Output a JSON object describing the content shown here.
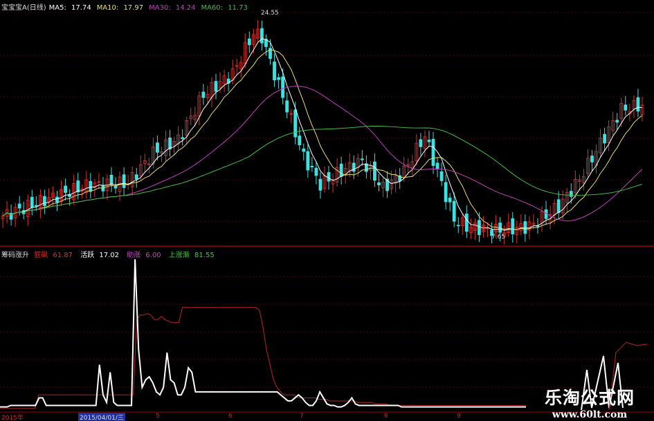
{
  "main_panel": {
    "title": "宝宝宝A(日线)",
    "ma5": {
      "label": "MA5:",
      "value": "17.74",
      "color": "#ffffff"
    },
    "ma10": {
      "label": "MA10:",
      "value": "17.97",
      "color": "#e8e070"
    },
    "ma30": {
      "label": "MA30:",
      "value": "14.24",
      "color": "#c040c0"
    },
    "ma60": {
      "label": "MA60:",
      "value": "11.73",
      "color": "#40c040"
    },
    "high_label": "24.55",
    "low_label": "7.65"
  },
  "indicator_panel": {
    "title": "筹码涨升",
    "items": [
      {
        "label": "狂飙",
        "value": "61.87",
        "color": "#e03030"
      },
      {
        "label": "活跃",
        "value": "17.02",
        "color": "#ffffff"
      },
      {
        "label": "助涨",
        "value": "6.00",
        "color": "#d040d0"
      },
      {
        "label": "上涨渐",
        "value": "81.55",
        "color": "#40d040"
      }
    ]
  },
  "x_axis": {
    "start": "2015年",
    "cursor": "2015/04/01/三",
    "months": [
      "5",
      "6",
      "7",
      "8",
      "9"
    ]
  },
  "watermark": {
    "name": "乐淘公式网",
    "url": "www.60lt.com"
  },
  "colors": {
    "up": "#e03030",
    "down": "#40e0e0",
    "grid": "#5a0000",
    "separator": "#a00000"
  },
  "chart_data": {
    "type": "candlestick",
    "price_range": [
      7.65,
      24.55
    ],
    "close_keypoints": [
      [
        0,
        9.1
      ],
      [
        10,
        10.3
      ],
      [
        20,
        11.4
      ],
      [
        30,
        11.6
      ],
      [
        36,
        13.9
      ],
      [
        42,
        14.9
      ],
      [
        48,
        18.3
      ],
      [
        55,
        19.9
      ],
      [
        60,
        23.0
      ],
      [
        62,
        22.7
      ],
      [
        65,
        19.9
      ],
      [
        68,
        17.3
      ],
      [
        72,
        13.6
      ],
      [
        76,
        11.5
      ],
      [
        81,
        12.5
      ],
      [
        86,
        13.3
      ],
      [
        91,
        11.2
      ],
      [
        96,
        12.5
      ],
      [
        101,
        15.2
      ],
      [
        104,
        12.5
      ],
      [
        108,
        8.8
      ],
      [
        111,
        8.3
      ],
      [
        118,
        8.0
      ],
      [
        126,
        8.3
      ],
      [
        133,
        9.8
      ],
      [
        138,
        11.9
      ],
      [
        143,
        14.6
      ],
      [
        148,
        17.2
      ],
      [
        153,
        17.5
      ]
    ],
    "indicator": {
      "range": [
        0,
        100
      ],
      "white": [
        2,
        2,
        2,
        3,
        3,
        3,
        3,
        3,
        3,
        3,
        3,
        8,
        8,
        3,
        3,
        3,
        3,
        3,
        3,
        3,
        3,
        3,
        3,
        3,
        3,
        3,
        3,
        3,
        30,
        10,
        5,
        25,
        5,
        3,
        3,
        3,
        3,
        3,
        100,
        40,
        15,
        20,
        22,
        18,
        12,
        10,
        15,
        38,
        20,
        18,
        10,
        10,
        15,
        28,
        25,
        12,
        12,
        12,
        12,
        12,
        12,
        12,
        12,
        12,
        12,
        12,
        12,
        12,
        12,
        12,
        12,
        12,
        12,
        12,
        12,
        12,
        12,
        12,
        12,
        10,
        8,
        6,
        6,
        8,
        10,
        8,
        5,
        3,
        3,
        6,
        12,
        8,
        4,
        3,
        3,
        2,
        2,
        3,
        5,
        8,
        4,
        3,
        3,
        3,
        3,
        3,
        3,
        3,
        3,
        3,
        3,
        3,
        3,
        2,
        2,
        2,
        2,
        2,
        2,
        2,
        2,
        2,
        2,
        2,
        2,
        2,
        2,
        2,
        2,
        2,
        2,
        2,
        2,
        2,
        2,
        2,
        2,
        2,
        2,
        2,
        2,
        2,
        2,
        2,
        2,
        2,
        2,
        2,
        2
      ],
      "red": [
        1,
        1,
        1,
        1,
        1,
        1,
        1,
        1,
        1,
        1,
        1,
        10,
        10,
        10,
        10,
        10,
        10,
        10,
        10,
        10,
        10,
        10,
        10,
        10,
        10,
        10,
        10,
        10,
        10,
        10,
        10,
        10,
        10,
        10,
        10,
        10,
        10,
        10,
        10,
        60,
        63,
        63,
        64,
        63,
        60,
        60,
        62,
        60,
        59,
        58,
        58,
        58,
        68,
        68,
        68,
        68,
        68,
        68,
        68,
        68,
        68,
        68,
        68,
        68,
        68,
        68,
        68,
        68,
        68,
        68,
        68,
        68,
        68,
        68,
        66,
        55,
        40,
        30,
        20,
        15,
        12,
        10,
        10,
        10,
        10,
        8,
        8,
        8,
        8,
        8,
        8,
        7,
        7,
        7,
        6,
        6,
        6,
        6,
        6,
        6,
        6,
        6,
        5,
        5,
        5,
        5,
        5,
        4,
        4,
        4,
        4,
        3,
        3,
        3,
        3,
        3,
        3,
        3,
        3,
        3,
        3,
        3,
        3,
        3,
        3,
        3,
        3,
        3,
        3,
        3,
        3,
        3,
        3,
        3,
        3,
        3,
        3,
        3,
        3,
        3,
        3,
        3,
        3,
        3,
        3,
        3,
        3,
        3,
        3,
        3,
        3
      ]
    }
  }
}
